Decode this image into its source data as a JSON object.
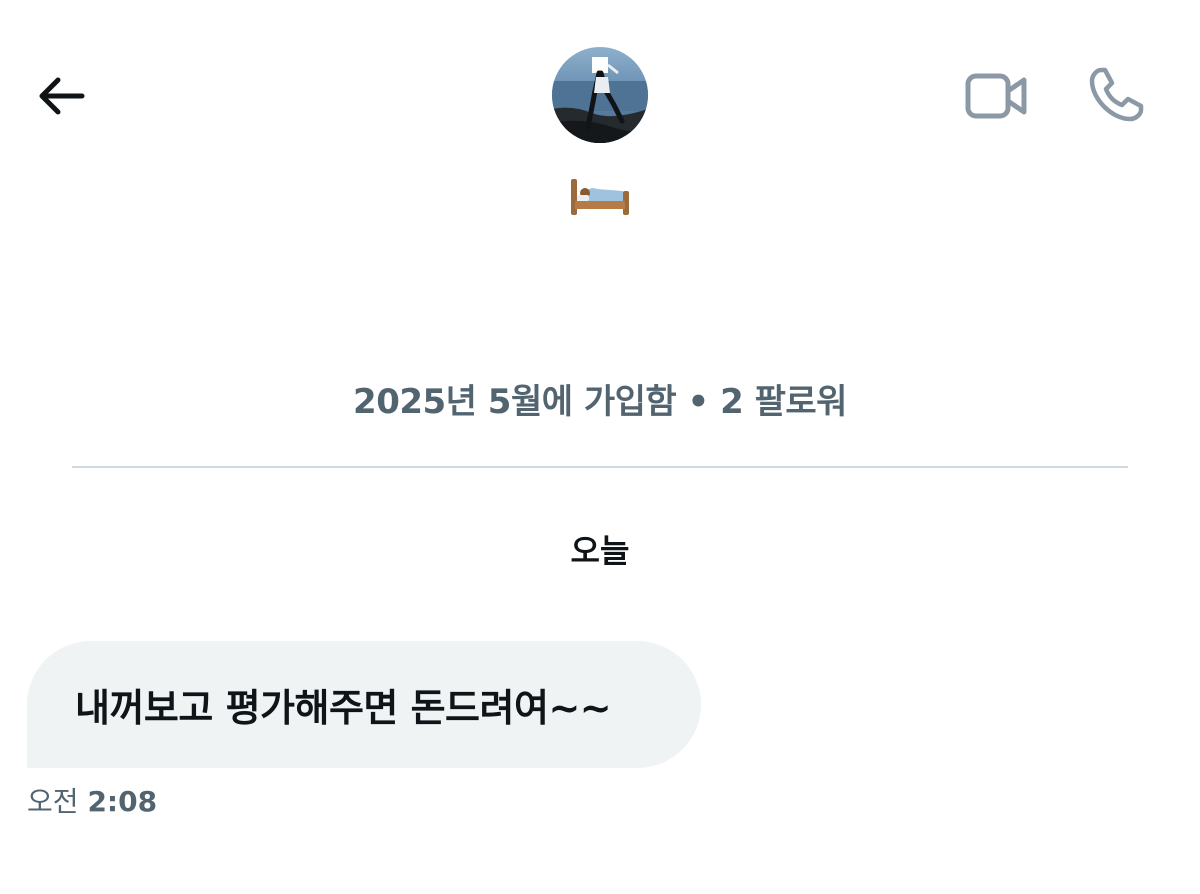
{
  "header": {
    "back_icon": "arrow-left-icon",
    "video_icon": "video-camera-icon",
    "call_icon": "phone-icon",
    "avatar_desc": "profile-photo",
    "display_name_emoji": "🛌🏽"
  },
  "profile": {
    "join_info": "2025년 5월에 가입함 • 2 팔로워"
  },
  "conversation": {
    "date_separator": "오늘",
    "messages": [
      {
        "text": "내꺼보고 평가해주면 돈드려여~~",
        "time_prefix": "오전",
        "time": "2:08",
        "direction": "incoming"
      }
    ]
  },
  "colors": {
    "bubble_bg": "#eff3f4",
    "secondary_text": "#536471",
    "icon_gray": "#8b98a5",
    "divider": "#cfd9de",
    "primary_text": "#0f1419"
  }
}
